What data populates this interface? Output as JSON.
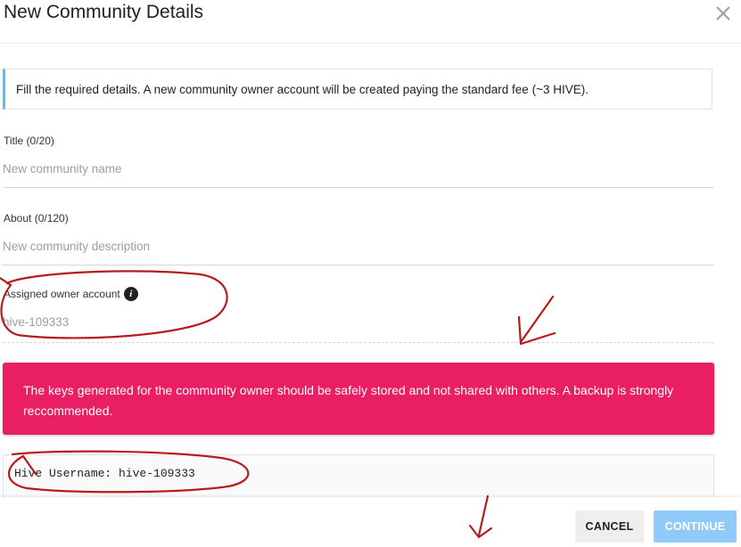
{
  "dialog": {
    "title": "New Community Details"
  },
  "info": {
    "text": "Fill the required details. A new community owner account will be created paying the standard fee (~3 HIVE)."
  },
  "fields": {
    "title": {
      "label": "Title (0/20)",
      "value": "",
      "placeholder": "New community name"
    },
    "about": {
      "label": "About (0/120)",
      "value": "",
      "placeholder": "New community description"
    },
    "owner": {
      "label": "Assigned owner account",
      "value": "hive-109333"
    }
  },
  "warning": {
    "text": "The keys generated for the community owner should be safely stored and not shared with others. A backup is strongly reccommended."
  },
  "keys": {
    "username_line": "Hive Username: hive-109333"
  },
  "footer": {
    "cancel_label": "CANCEL",
    "continue_label": "CONTINUE"
  },
  "colors": {
    "warning_bg": "#e91e63",
    "info_accent": "#4fc3f7",
    "continue_bg": "#90caf9",
    "annotation_red": "#b71c1c"
  },
  "icons": {
    "close": "close-icon",
    "info": "info-icon"
  }
}
